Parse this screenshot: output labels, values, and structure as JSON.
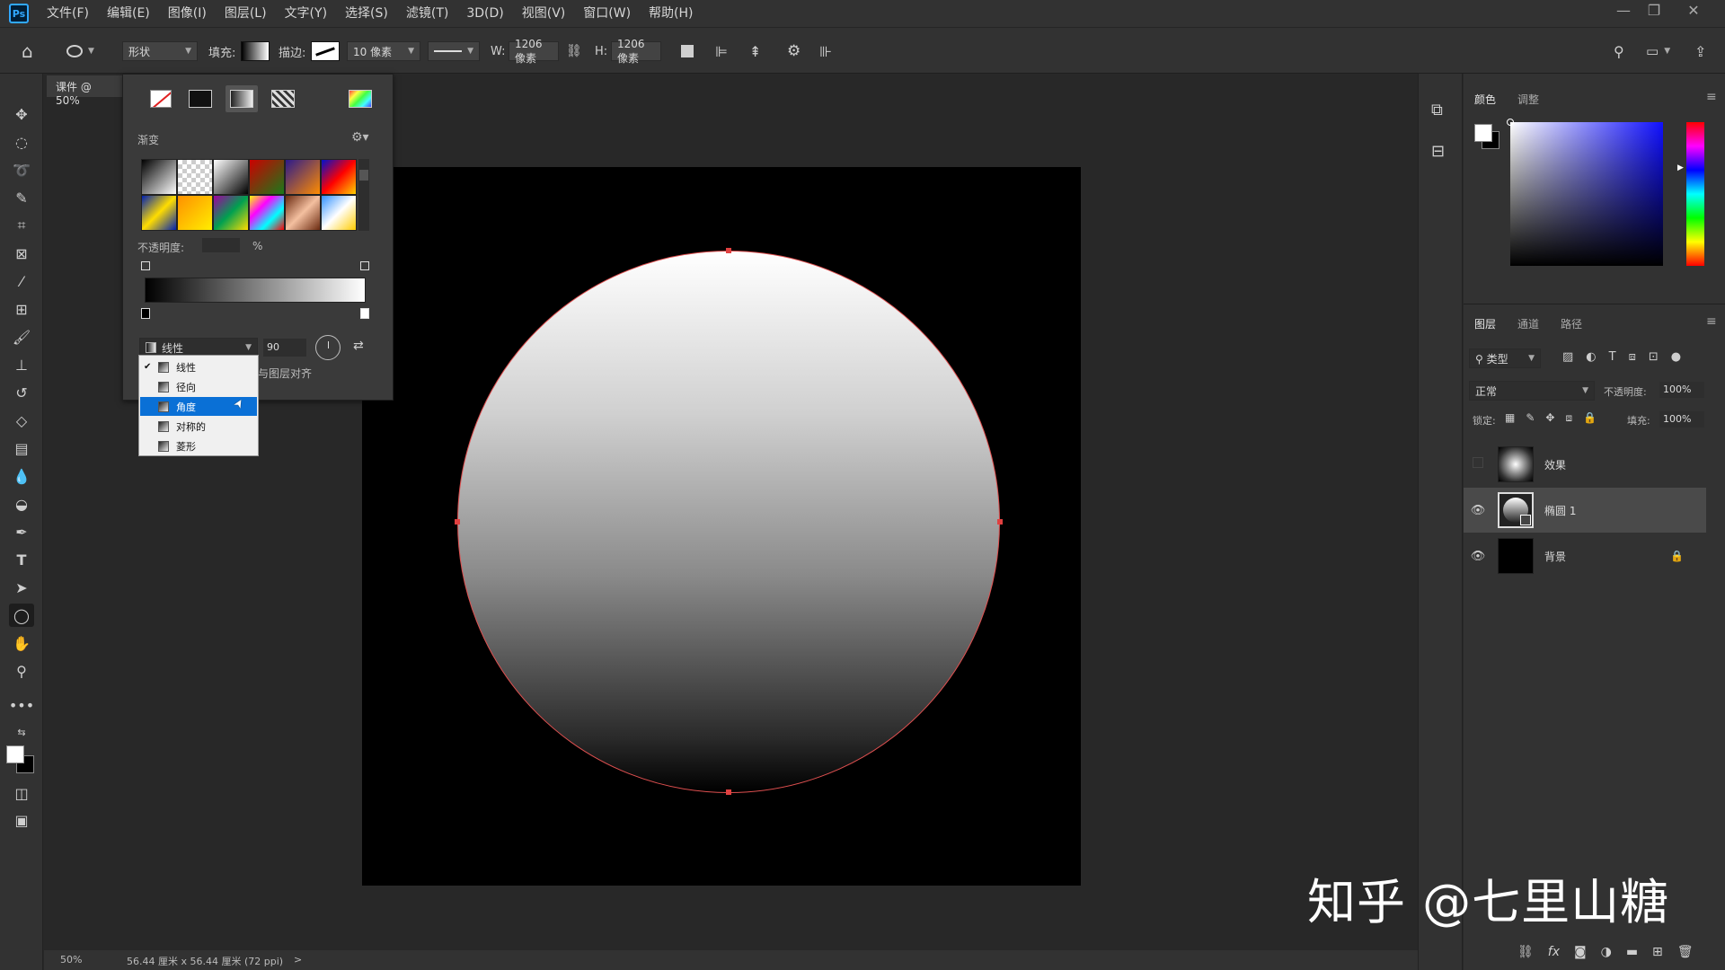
{
  "menubar": {
    "logo": "Ps",
    "items": [
      "文件(F)",
      "编辑(E)",
      "图像(I)",
      "图层(L)",
      "文字(Y)",
      "选择(S)",
      "滤镜(T)",
      "3D(D)",
      "视图(V)",
      "窗口(W)",
      "帮助(H)"
    ]
  },
  "options": {
    "mode": "形状",
    "fill_label": "填充:",
    "stroke_label": "描边:",
    "stroke_size": "10 像素",
    "w_label": "W:",
    "w_value": "1206 像素",
    "h_label": "H:",
    "h_value": "1206 像素"
  },
  "document": {
    "tab_title": "课件 @ 50%"
  },
  "gradient_panel": {
    "section_title": "渐变",
    "opacity_label": "不透明度:",
    "opacity_unit": "%",
    "type_selected": "线性",
    "angle_value": "90",
    "align_label": "与图层对齐",
    "gradient_types": [
      "线性",
      "径向",
      "角度",
      "对称的",
      "菱形"
    ],
    "checked_type": "线性",
    "hover_type": "角度"
  },
  "color_panel": {
    "tabs": [
      "颜色",
      "调整"
    ],
    "active_tab": "颜色"
  },
  "layers_panel": {
    "tabs": [
      "图层",
      "通道",
      "路径"
    ],
    "active_tab": "图层",
    "filter_label": "类型",
    "blend_mode": "正常",
    "opacity_label": "不透明度:",
    "opacity_value": "100%",
    "lock_label": "锁定:",
    "fill_label": "填充:",
    "fill_value": "100%",
    "layers": [
      {
        "name": "效果",
        "visible": false,
        "locked": false
      },
      {
        "name": "椭圆 1",
        "visible": true,
        "locked": false,
        "selected": true
      },
      {
        "name": "背景",
        "visible": true,
        "locked": true
      }
    ]
  },
  "status": {
    "zoom": "50%",
    "doc_size": "56.44 厘米 x 56.44 厘米 (72 ppi)",
    "arrow": ">"
  },
  "watermark": "知乎 @七里山糖",
  "colors": {
    "accent": "#0a70d6",
    "anchor": "#e04040",
    "ps_blue": "#31a8ff"
  }
}
